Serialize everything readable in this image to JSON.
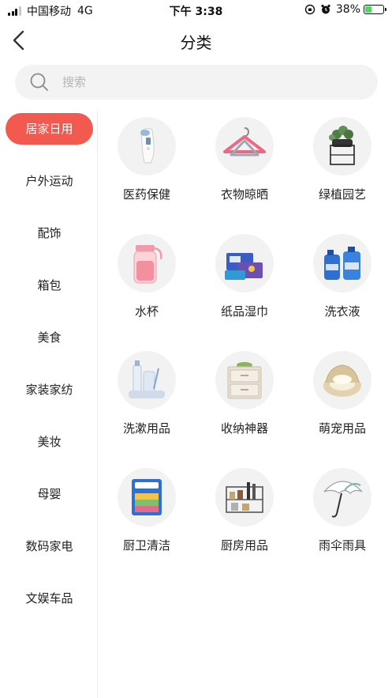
{
  "status_bar": {
    "carrier": "中国移动",
    "network": "4G",
    "time": "下午 3:38",
    "battery": "38%",
    "battery_level": 0.38
  },
  "nav": {
    "back_icon": "chevron-left-icon",
    "title": "分类"
  },
  "search": {
    "placeholder": "搜索",
    "value": "",
    "icon": "search-icon"
  },
  "colors": {
    "accent": "#f25a50",
    "search_bg": "#f3f3f3",
    "thumb_bg": "#f2f2f2",
    "battery_fill": "#4cd964"
  },
  "sidebar": {
    "active_index": 0,
    "items": [
      {
        "label": "居家日用"
      },
      {
        "label": "户外运动"
      },
      {
        "label": "配饰"
      },
      {
        "label": "箱包"
      },
      {
        "label": "美食"
      },
      {
        "label": "家装家纺"
      },
      {
        "label": "美妆"
      },
      {
        "label": "母婴"
      },
      {
        "label": "数码家电"
      },
      {
        "label": "文娱车品"
      }
    ]
  },
  "categories": [
    {
      "label": "医药保健",
      "icon": "thermometer-icon"
    },
    {
      "label": "衣物晾晒",
      "icon": "hanger-icon"
    },
    {
      "label": "绿植园艺",
      "icon": "potted-plant-icon"
    },
    {
      "label": "水杯",
      "icon": "water-bottle-icon"
    },
    {
      "label": "纸品湿巾",
      "icon": "tissue-box-icon"
    },
    {
      "label": "洗衣液",
      "icon": "detergent-bottle-icon"
    },
    {
      "label": "洗漱用品",
      "icon": "toiletries-icon"
    },
    {
      "label": "收纳神器",
      "icon": "storage-drawer-icon"
    },
    {
      "label": "萌宠用品",
      "icon": "pet-bed-icon"
    },
    {
      "label": "厨卫清洁",
      "icon": "sponge-icon"
    },
    {
      "label": "厨房用品",
      "icon": "kitchen-rack-icon"
    },
    {
      "label": "雨伞雨具",
      "icon": "umbrella-icon"
    }
  ]
}
